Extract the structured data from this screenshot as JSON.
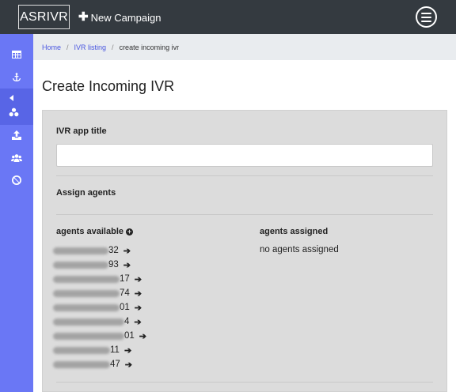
{
  "header": {
    "brand": "ASRIVR",
    "new_campaign_label": "New Campaign",
    "new_campaign_icon": "plus-icon",
    "menu_icon": "hamburger-menu-icon"
  },
  "sidebar": {
    "items": [
      {
        "icon": "table-icon"
      },
      {
        "icon": "anchor-icon"
      },
      {
        "icon": "caret-left-icon",
        "active": true
      },
      {
        "icon": "biohazard-icon",
        "active": true
      },
      {
        "icon": "upload-icon"
      },
      {
        "icon": "users-icon"
      },
      {
        "icon": "ban-icon"
      }
    ],
    "color": "#6a77f5"
  },
  "breadcrumb": {
    "home": "Home",
    "listing": "IVR listing",
    "current": "create incoming ivr"
  },
  "page": {
    "title": "Create Incoming IVR"
  },
  "form": {
    "ivr_title_label": "IVR app title",
    "ivr_title_value": "",
    "assign_agents_label": "Assign agents",
    "agents_available_label": "agents available",
    "agents_assigned_label": "agents assigned",
    "no_agents_text": "no agents assigned",
    "agents_available": [
      {
        "visible_suffix": "32"
      },
      {
        "visible_suffix": "93"
      },
      {
        "visible_suffix": "17"
      },
      {
        "visible_suffix": "74"
      },
      {
        "visible_suffix": "01"
      },
      {
        "visible_suffix": "4"
      },
      {
        "visible_suffix": "01"
      },
      {
        "visible_suffix": "11"
      },
      {
        "visible_suffix": "47"
      }
    ]
  },
  "colors": {
    "topbar": "#343a40",
    "sidebar": "#6a77f5",
    "link": "#4a57e0",
    "card": "#dcdcdc"
  }
}
